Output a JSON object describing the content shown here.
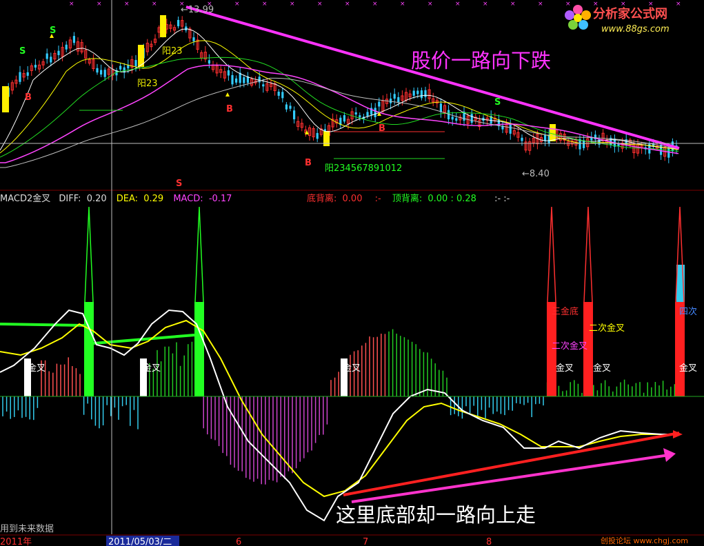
{
  "watermark": {
    "brand": "分析家公式网",
    "url": "www.88gs.com",
    "bottom_credit": "创投论坛 www.chgj.com"
  },
  "price_panel": {
    "high_label": "←13.99",
    "low_label": "←8.40",
    "annotation": "股价一路向下跌",
    "yang_labels": [
      "阳23",
      "阳23",
      "阳234567891012"
    ],
    "signal_S": "S",
    "signal_B": "B"
  },
  "indicator_header": {
    "name": "MACD2金叉",
    "diff_label": "DIFF:",
    "diff_value": "0.20",
    "dea_label": "DEA:",
    "dea_value": "0.29",
    "macd_label": "MACD:",
    "macd_value": "-0.17",
    "bottom_div_label": "底背离:",
    "bottom_div_value": "0.00",
    "bottom_div_extra": ":-",
    "top_div_label": "顶背离:",
    "top_div_value": "0.00 : 0.28",
    "tail": ":-  :-"
  },
  "macd_panel": {
    "annotation": "这里底部却一路向上走",
    "labels": [
      "金叉",
      "金叉",
      "金叉",
      "三金底",
      "二次金叉",
      "二次金叉",
      "金叉",
      "金叉",
      "四次",
      "金叉"
    ],
    "footer_note": "用到未来数据"
  },
  "time_axis": {
    "labels": [
      "2011年",
      "2011/05/03/二",
      "6",
      "7",
      "8"
    ]
  },
  "colors": {
    "background": "#000000",
    "up": "#ff3030",
    "down": "#33ccff",
    "diff": "#ffffff",
    "dea": "#ffff00",
    "macd_label": "#ff44ff",
    "trend_down": "#ff33ff",
    "trend_up": "#ff2020",
    "cross_bar_green": "#22ff22",
    "cross_bar_red": "#ff2020"
  },
  "chart_data": {
    "type": "line",
    "series": [
      {
        "name": "DIFF",
        "current": 0.2
      },
      {
        "name": "DEA",
        "current": 0.29
      },
      {
        "name": "MACD",
        "current": -0.17
      }
    ],
    "price_high": 13.99,
    "price_low": 8.4
  }
}
